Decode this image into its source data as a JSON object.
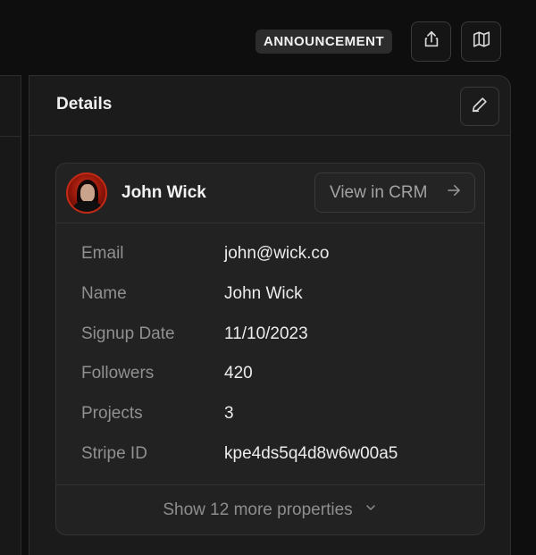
{
  "toolbar": {
    "badge_label": "ANNOUNCEMENT",
    "share_icon": "share-icon",
    "map_icon": "map-icon"
  },
  "details": {
    "title": "Details",
    "edit_icon": "pencil-icon"
  },
  "contact": {
    "name": "John Wick",
    "crm_button_label": "View in CRM",
    "crm_icon": "arrow-right-icon",
    "properties": [
      {
        "key": "Email",
        "value": "john@wick.co"
      },
      {
        "key": "Name",
        "value": "John Wick"
      },
      {
        "key": "Signup Date",
        "value": "11/10/2023"
      },
      {
        "key": "Followers",
        "value": "420"
      },
      {
        "key": "Projects",
        "value": "3"
      },
      {
        "key": "Stripe ID",
        "value": "kpe4ds5q4d8w6w00a5"
      }
    ],
    "show_more_label": "Show 12 more properties",
    "show_more_icon": "chevron-down-icon"
  },
  "colors": {
    "background": "#0e0e0e",
    "panel": "#1b1b1b",
    "card": "#222222",
    "text_primary": "#f2f2f2",
    "text_muted": "#909090",
    "avatar_accent": "#c02a16"
  }
}
